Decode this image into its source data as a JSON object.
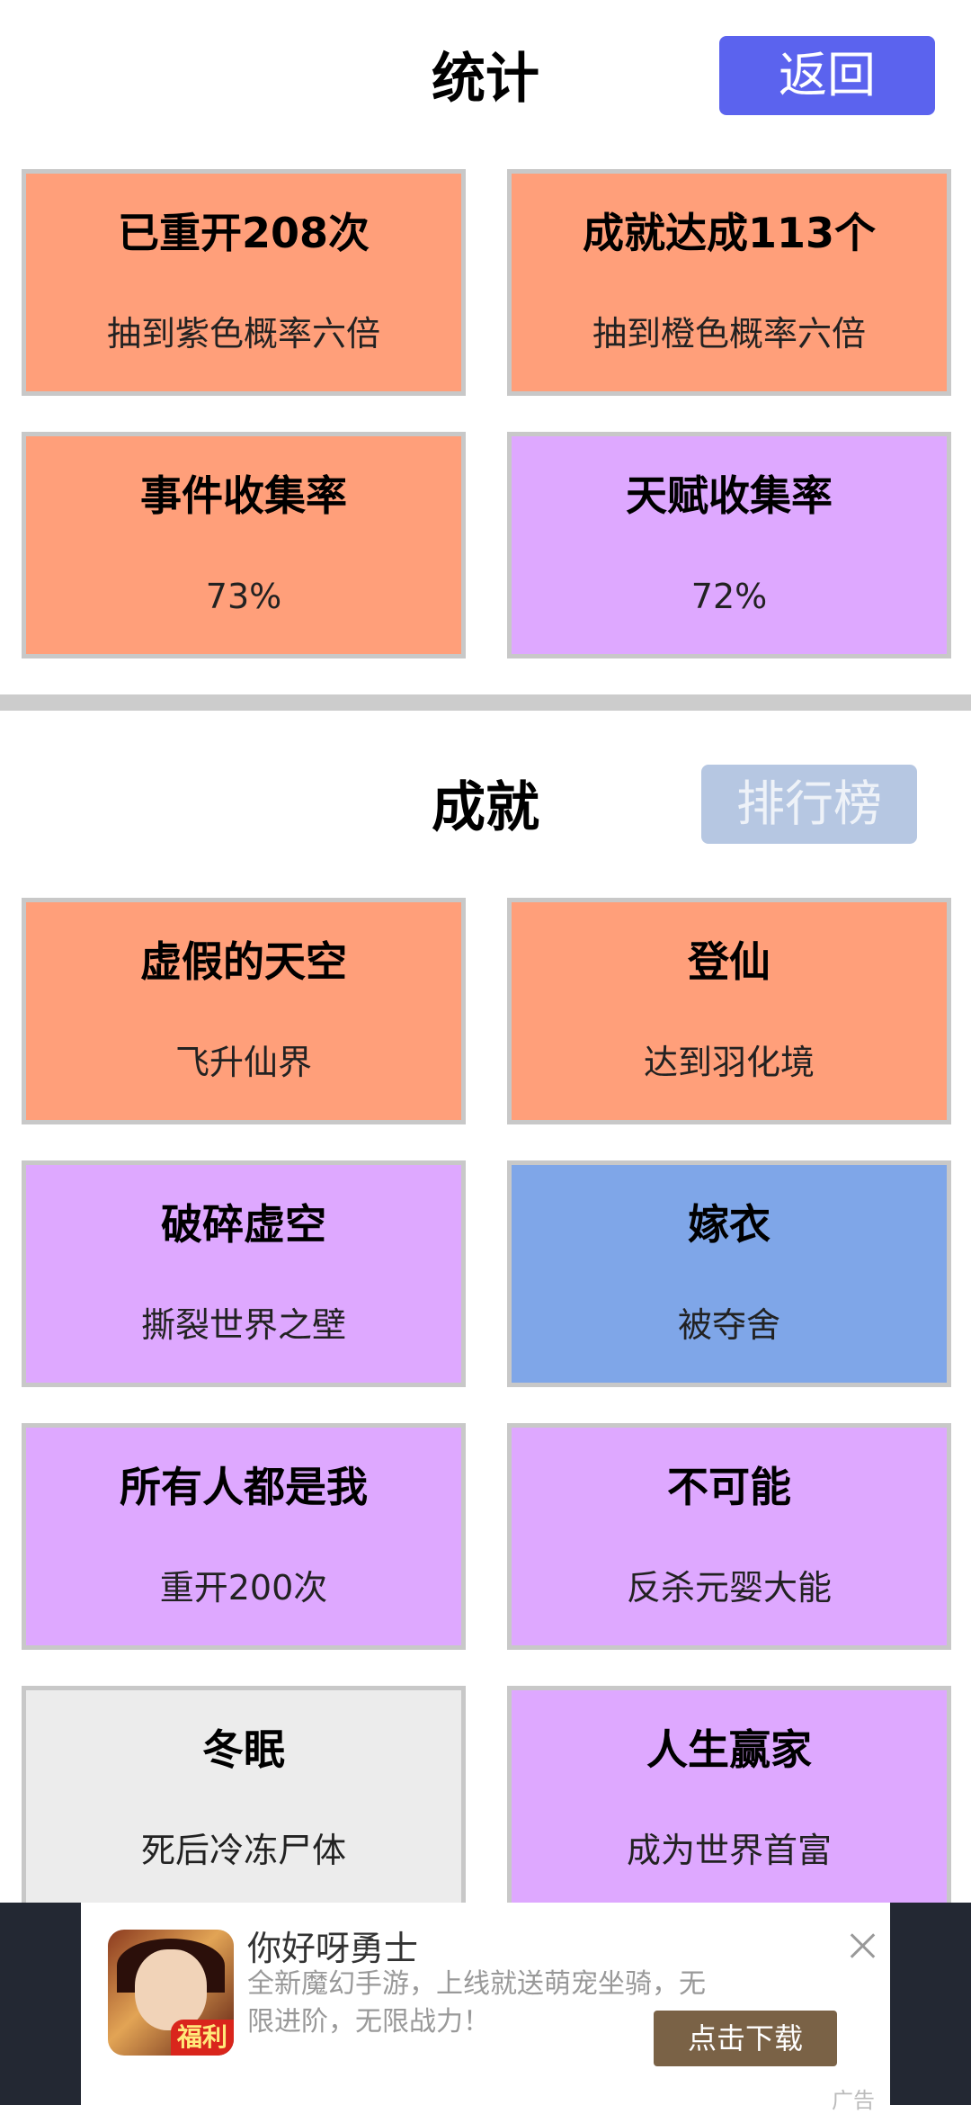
{
  "stats": {
    "title": "统计",
    "back_label": "返回",
    "cards": [
      {
        "title": "已重开208次",
        "sub": "抽到紫色概率六倍",
        "color": "#ff9f7a"
      },
      {
        "title": "成就达成113个",
        "sub": "抽到橙色概率六倍",
        "color": "#ff9f7a"
      },
      {
        "title": "事件收集率",
        "sub": "73%",
        "color": "#ff9f7a"
      },
      {
        "title": "天赋收集率",
        "sub": "72%",
        "color": "#dea8ff"
      }
    ]
  },
  "achievements": {
    "title": "成就",
    "rank_label": "排行榜",
    "cards": [
      {
        "title": "虚假的天空",
        "sub": "飞升仙界",
        "color": "#ff9f7a"
      },
      {
        "title": "登仙",
        "sub": "达到羽化境",
        "color": "#ff9f7a"
      },
      {
        "title": "破碎虚空",
        "sub": "撕裂世界之壁",
        "color": "#dea8ff"
      },
      {
        "title": "嫁衣",
        "sub": "被夺舍",
        "color": "#7fa6e8"
      },
      {
        "title": "所有人都是我",
        "sub": "重开200次",
        "color": "#dea8ff"
      },
      {
        "title": "不可能",
        "sub": "反杀元婴大能",
        "color": "#dea8ff"
      },
      {
        "title": "冬眠",
        "sub": "死后冷冻尸体",
        "color": "#ececec"
      },
      {
        "title": "人生赢家",
        "sub": "成为世界首富",
        "color": "#dea8ff"
      }
    ]
  },
  "ad": {
    "icon_tag": "福利",
    "title": "你好呀勇士",
    "desc": "全新魔幻手游，上线就送萌宠坐骑，无限进阶，无限战力！",
    "button": "点击下载",
    "mark": "广告"
  }
}
